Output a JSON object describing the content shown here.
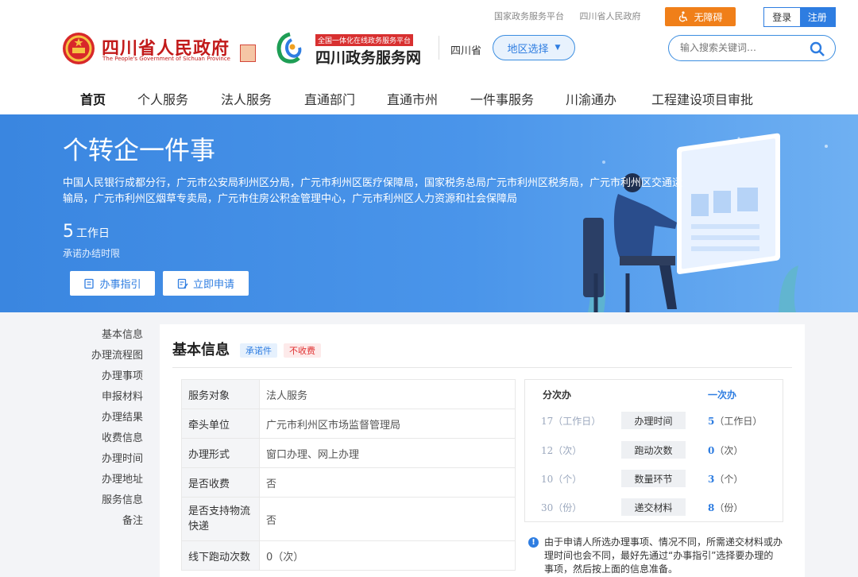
{
  "top_links": [
    "国家政务服务平台",
    "四川省人民政府"
  ],
  "accessibility_label": "无障碍",
  "auth": {
    "login": "登录",
    "register": "注册"
  },
  "logo_gov": {
    "title": "四川省人民政府",
    "subtitle": "The People's Government of Sichuan Province"
  },
  "logo_service": {
    "tag": "全国一体化在线政务服务平台",
    "title": "四川政务服务网"
  },
  "province": "四川省",
  "region_select": "地区选择",
  "search": {
    "placeholder": "输入搜索关键词…"
  },
  "nav": [
    "首页",
    "个人服务",
    "法人服务",
    "直通部门",
    "直通市州",
    "一件事服务",
    "川渝通办",
    "工程建设项目审批"
  ],
  "banner": {
    "title": "个转企一件事",
    "departments": "中国人民银行成都分行，广元市公安局利州区分局，广元市利州区医疗保障局，国家税务总局广元市利州区税务局，广元市利州区交通运输局，广元市利州区烟草专卖局，广元市住房公积金管理中心，广元市利州区人力资源和社会保障局",
    "days": "5",
    "days_unit": "工作日",
    "limit_label": "承诺办结时限",
    "guide_button": "办事指引",
    "apply_button": "立即申请"
  },
  "side_nav": [
    "基本信息",
    "办理流程图",
    "办理事项",
    "申报材料",
    "办理结果",
    "收费信息",
    "办理时间",
    "办理地址",
    "服务信息",
    "备注"
  ],
  "section": {
    "title": "基本信息",
    "tag_promise": "承诺件",
    "tag_fee": "不收费"
  },
  "info_rows": [
    {
      "key": "服务对象",
      "value": "法人服务"
    },
    {
      "key": "牵头单位",
      "value": "广元市利州区市场监督管理局"
    },
    {
      "key": "办理形式",
      "value": "窗口办理、网上办理"
    },
    {
      "key": "是否收费",
      "value": "否"
    },
    {
      "key": "是否支持物流快递",
      "value": "否"
    },
    {
      "key": "线下跑动次数",
      "value": "0（次）"
    }
  ],
  "stats": {
    "left_header": "分次办",
    "right_header": "一次办",
    "rows": [
      {
        "left": "17（工作日）",
        "label": "办理时间",
        "right_num": "5",
        "right_unit": "（工作日）"
      },
      {
        "left": "12（次）",
        "label": "跑动次数",
        "right_num": "0",
        "right_unit": "（次）"
      },
      {
        "left": "10（个）",
        "label": "数量环节",
        "right_num": "3",
        "right_unit": "（个）"
      },
      {
        "left": "30（份）",
        "label": "递交材料",
        "right_num": "8",
        "right_unit": "（份）"
      }
    ]
  },
  "note": "由于申请人所选办理事项、情况不同，所需递交材料或办理时间也会不同，最好先通过“办事指引”选择要办理的事项，然后按上面的信息准备。",
  "colors": {
    "accent": "#2e7de1",
    "gov_red": "#c21a1a",
    "access_orange": "#f07f19",
    "banner_blue": "#3a86e0"
  }
}
